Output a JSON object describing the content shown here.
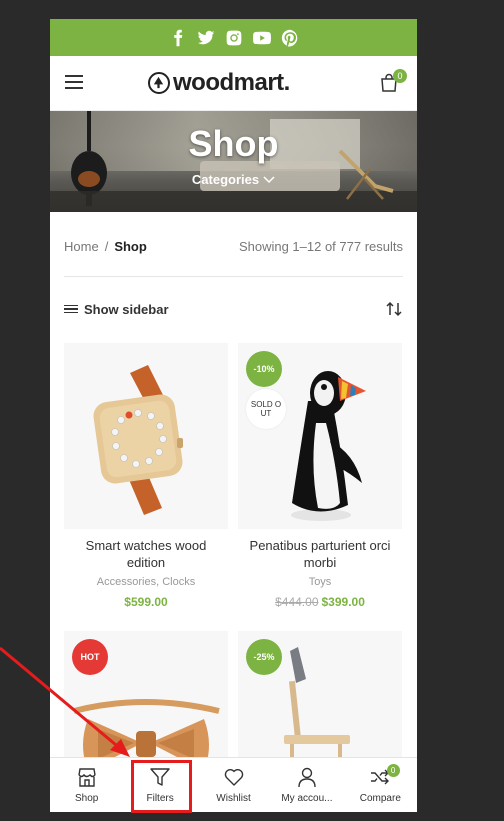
{
  "social": [
    "facebook-icon",
    "twitter-icon",
    "instagram-icon",
    "youtube-icon",
    "pinterest-icon"
  ],
  "header": {
    "logo": "woodmart.",
    "cart_count": "0"
  },
  "banner": {
    "title": "Shop",
    "categories": "Categories"
  },
  "breadcrumb": {
    "home": "Home",
    "separator": "/",
    "current": "Shop"
  },
  "results": "Showing 1–12 of 777 results",
  "toolbar": {
    "show_sidebar": "Show sidebar"
  },
  "products": [
    {
      "name": "Smart watches wood edition",
      "categories": "Accessories, Clocks",
      "price": "$599.00",
      "old_price": ""
    },
    {
      "name": "Penatibus parturient orci morbi",
      "categories": "Toys",
      "price": "$399.00",
      "old_price": "$444.00",
      "badge": "-10%",
      "sold_out": "SOLD OUT"
    },
    {
      "badge": "HOT"
    },
    {
      "badge": "-25%"
    }
  ],
  "sold_out_lines": [
    "SOLD O",
    "UT"
  ],
  "bottom_nav": [
    {
      "label": "Shop",
      "icon": "store-icon"
    },
    {
      "label": "Filters",
      "icon": "filter-icon"
    },
    {
      "label": "Wishlist",
      "icon": "heart-icon"
    },
    {
      "label": "My accou...",
      "icon": "user-icon"
    },
    {
      "label": "Compare",
      "icon": "shuffle-icon",
      "badge": "0"
    }
  ],
  "colors": {
    "accent": "#7cb342",
    "hot": "#e53935",
    "annotation": "#e51c1c",
    "background": "#2a2a2a"
  }
}
